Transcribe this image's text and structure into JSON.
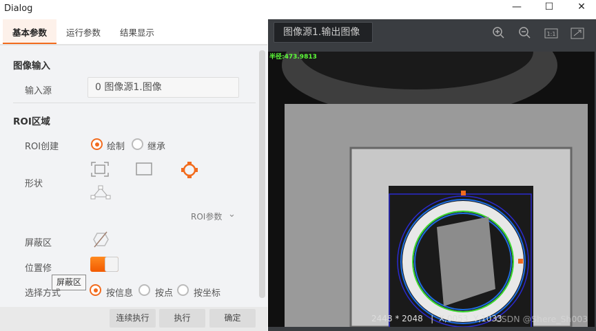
{
  "window": {
    "title": "Dialog",
    "min": "—",
    "max": "☐",
    "close": "✕"
  },
  "tabs": [
    {
      "label": "基本参数"
    },
    {
      "label": "运行参数"
    },
    {
      "label": "结果显示"
    }
  ],
  "image_input": {
    "heading": "图像输入",
    "source_label": "输入源",
    "source_value": "0 图像源1.图像"
  },
  "roi": {
    "heading": "ROI区域",
    "create_label": "ROI创建",
    "create_options": [
      "绘制",
      "继承"
    ],
    "shape_label": "形状",
    "params_label": "ROI参数",
    "mask_label": "屏蔽区",
    "position_label": "位置修",
    "tooltip": "屏蔽区",
    "select_label": "选择方式",
    "select_options": [
      "按信息",
      "按点",
      "按坐标"
    ]
  },
  "footer": {
    "continuous": "连续执行",
    "run": "执行",
    "ok": "确定"
  },
  "viewer": {
    "source": "图像源1.输出图像",
    "radius_text": "半径:473.9813",
    "status": "2448 * 2048   |  X,0053  Y,1033",
    "watermark": "CSDN @Shere_Sh003"
  },
  "colors": {
    "accent": "#f26b1d",
    "roi": "#1e6ee0",
    "green": "#38d830"
  }
}
